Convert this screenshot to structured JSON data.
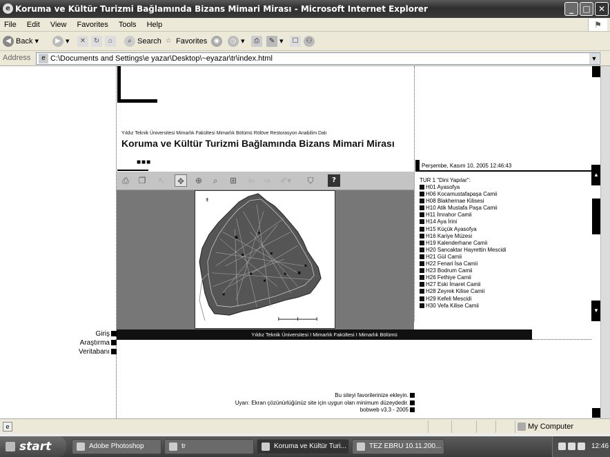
{
  "window": {
    "title": "Koruma ve Kültür Turizmi Bağlamında Bizans Mimari Mirası - Microsoft Internet Explorer",
    "controls": {
      "minimize": "_",
      "maximize": "□",
      "close": "✕"
    }
  },
  "menu": {
    "items": [
      "File",
      "Edit",
      "View",
      "Favorites",
      "Tools",
      "Help"
    ]
  },
  "toolbar": {
    "back_label": "Back",
    "search_label": "Search",
    "favorites_label": "Favorites"
  },
  "address": {
    "label": "Address",
    "url": "C:\\Documents and Settings\\e yazar\\Desktop\\~eyazar\\tr\\index.html"
  },
  "header": {
    "subtitle": "Yıldız Teknik Üniversitesi Mimarlık Fakültesi Mimarlık Bölümü Rölöve Restorasyon Anabilim Dalı",
    "title": "Koruma ve Kültür Turizmi Bağlamında Bizans Mimari Mirası",
    "dots": "■■■"
  },
  "datetime": "Perşembe, Kasım 10, 2005 12:46:43",
  "map_toolbar": {
    "icons": [
      "print-icon",
      "copy-icon",
      "pointer-icon",
      "pan-icon",
      "zoom-extents-icon",
      "zoom-in-icon",
      "zoom-window-icon",
      "back-arrow-icon",
      "forward-arrow-icon",
      "tool-dropdown-icon",
      "layers-icon",
      "help-icon"
    ]
  },
  "tour": {
    "heading": "TUR 1 \"Dini Yapılar\":",
    "items": [
      "H01 Ayasofya",
      "H06 Kocamustafapaşa Camii",
      "H08 Blakhernae Kilisesi",
      "H10 Atik Mustafa Paşa Camii",
      "H11 İmrahor Camii",
      "H14 Aya İrini",
      "H15 Küçük Ayasofya",
      "H16 Kariye Müzesi",
      "H19 Kalenderhane Camii",
      "H20 Sancaktar Hayrettin Mescidi",
      "H21 Gül Camii",
      "H22 Fenari İsa Camii",
      "H23 Bodrum Camii",
      "H26 Fethiye Camii",
      "H27 Eski İmaret Camii",
      "H28 Zeyrek Kilise Camii",
      "H29 Kefeli Mescidi",
      "H30 Vefa Kilise Camii"
    ]
  },
  "footer_bar": "Yıldız Teknik Üniversitesi I Mimarlık Fakültesi I Mimarlık Bölümü",
  "nav": {
    "items": [
      "Giriş",
      "Araştırma",
      "Veritabanı"
    ]
  },
  "notes": {
    "lines": [
      "Bu siteyi favorilerinize ekleyin.",
      "Uyarı: Ekran çözünürlüğünüz site için uygun olan minimum düzeydedir.",
      "bobweb v3.3 - 2005"
    ]
  },
  "status": {
    "zone": "My Computer"
  },
  "taskbar": {
    "start": "start",
    "tasks": [
      "Adobe Photoshop",
      "tr",
      "Koruma ve Kültür Turi...",
      "TEZ EBRU 10.11.200..."
    ],
    "clock": "12:46"
  }
}
